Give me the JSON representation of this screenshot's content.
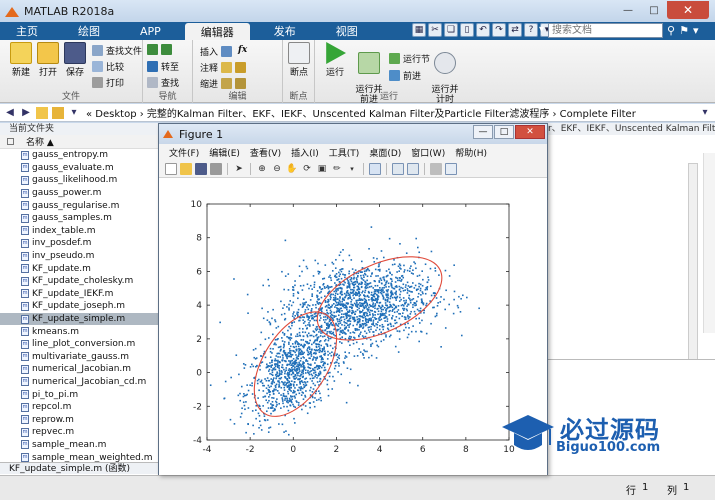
{
  "window": {
    "title": "MATLAB R2018a"
  },
  "tabs": [
    "主页",
    "绘图",
    "APP",
    "编辑器",
    "发布",
    "视图"
  ],
  "active_tab": "编辑器",
  "search": {
    "placeholder": "搜索文档"
  },
  "ribbon": {
    "file_group": {
      "label": "文件",
      "new": "新建",
      "open": "打开",
      "save": "保存",
      "find_files": "查找文件",
      "compare": "比较",
      "print": "打印"
    },
    "nav_group": {
      "label": "导航",
      "goto": "转至",
      "find": "查找"
    },
    "edit_group": {
      "label": "编辑",
      "insert": "插入",
      "comment": "注释",
      "indent": "缩进",
      "fx": "fx"
    },
    "breakpoint_group": {
      "label": "断点",
      "breakpoint": "断点"
    },
    "run_group": {
      "label": "运行",
      "run": "运行",
      "run_advance": "运行并\n前进",
      "run_section": "运行节",
      "advance": "前进",
      "run_time": "运行并\n计时"
    }
  },
  "address": {
    "path": "« Desktop › 完整的Kalman Filter、EKF、IEKF、Unscented Kalman Filter及Particle Filter滤波程序 › Complete  Filter"
  },
  "file_panel": {
    "title": "当前文件夹",
    "column_header": "名称 ▲",
    "files": [
      "gauss_entropy.m",
      "gauss_evaluate.m",
      "gauss_likelihood.m",
      "gauss_power.m",
      "gauss_regularise.m",
      "gauss_samples.m",
      "index_table.m",
      "inv_posdef.m",
      "inv_pseudo.m",
      "KF_update.m",
      "KF_update_cholesky.m",
      "KF_update_IEKF.m",
      "KF_update_joseph.m",
      "KF_update_simple.m",
      "kmeans.m",
      "line_plot_conversion.m",
      "multivariate_gauss.m",
      "numerical_Jacobian.m",
      "numerical_Jacobian_cd.m",
      "pi_to_pi.m",
      "repcol.m",
      "reprow.m",
      "repvec.m",
      "sample_mean.m",
      "sample_mean_weighted.m"
    ],
    "selected_index": 13,
    "detail": "KF_update_simple.m  (函数)"
  },
  "right_panel": {
    "title": "r、EKF、IEKF、Unscented Kalman Filter及..."
  },
  "status": {
    "row_label": "行",
    "row_value": "1",
    "col_label": "列",
    "col_value": "1"
  },
  "figure": {
    "title": "Figure 1",
    "menu": [
      "文件(F)",
      "编辑(E)",
      "查看(V)",
      "插入(I)",
      "工具(T)",
      "桌面(D)",
      "窗口(W)",
      "帮助(H)"
    ]
  },
  "watermark": {
    "brand": "必过源码",
    "url": "Biguo100.com"
  },
  "colors": {
    "point": "#1f6fb8",
    "ellipse": "#e04a3a",
    "accent": "#1c5e9a"
  },
  "chart_data": {
    "type": "scatter",
    "title": "",
    "xlabel": "",
    "ylabel": "",
    "xlim": [
      -4,
      10
    ],
    "ylim": [
      -4,
      10
    ],
    "xticks": [
      -4,
      -2,
      0,
      2,
      4,
      6,
      8,
      10
    ],
    "yticks": [
      -4,
      -2,
      0,
      2,
      4,
      6,
      8,
      10
    ],
    "clusters": [
      {
        "center": [
          0,
          0
        ],
        "sd": [
          1.1,
          1.4
        ],
        "corr": 0.45,
        "count": 900
      },
      {
        "center": [
          3,
          4
        ],
        "sd": [
          1.7,
          1.3
        ],
        "corr": 0.25,
        "count": 1500
      }
    ],
    "ellipses": [
      {
        "center": [
          0.1,
          0.5
        ],
        "rx": 2.7,
        "ry": 1.9,
        "angle_deg": 58
      },
      {
        "center": [
          4.0,
          4.4
        ],
        "rx": 3.1,
        "ry": 2.0,
        "angle_deg": 25
      }
    ]
  }
}
